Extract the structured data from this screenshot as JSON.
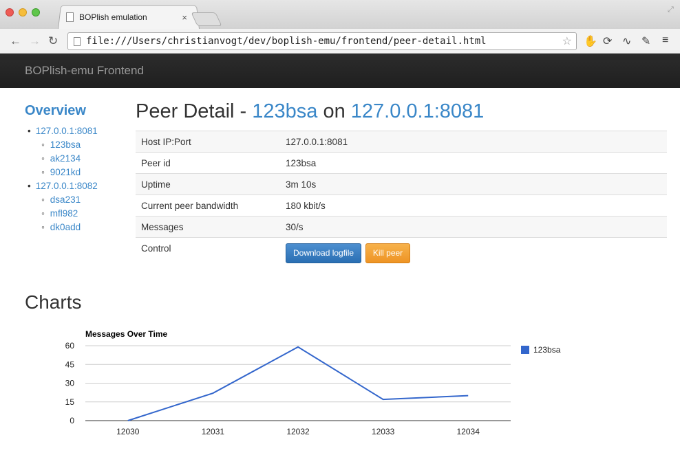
{
  "browser": {
    "tab_title": "BOPlish emulation",
    "tab_close": "×",
    "url": "file:///Users/christianvogt/dev/boplish-emu/frontend/peer-detail.html"
  },
  "navbar": {
    "brand": "BOPlish-emu Frontend"
  },
  "sidebar": {
    "heading": "Overview",
    "hosts": [
      {
        "label": "127.0.0.1:8081",
        "peers": [
          "123bsa",
          "ak2134",
          "9021kd"
        ]
      },
      {
        "label": "127.0.0.1:8082",
        "peers": [
          "dsa231",
          "mfl982",
          "dk0add"
        ]
      }
    ]
  },
  "page": {
    "title_prefix": "Peer Detail - ",
    "peer": "123bsa",
    "title_on": " on ",
    "host": "127.0.0.1:8081"
  },
  "details": [
    {
      "key": "Host IP:Port",
      "value": "127.0.0.1:8081"
    },
    {
      "key": "Peer id",
      "value": "123bsa"
    },
    {
      "key": "Uptime",
      "value": "3m 10s"
    },
    {
      "key": "Current peer bandwidth",
      "value": "180 kbit/s"
    },
    {
      "key": "Messages",
      "value": "30/s"
    }
  ],
  "control": {
    "label": "Control",
    "download_label": "Download logfile",
    "kill_label": "Kill peer"
  },
  "charts_heading": "Charts",
  "colors": {
    "accent": "#3a87c8",
    "series": "#3366cc",
    "warning": "#ee9425"
  },
  "chart_data": {
    "type": "line",
    "title": "Messages Over Time",
    "categories": [
      "12030",
      "12031",
      "12032",
      "12033",
      "12034"
    ],
    "series": [
      {
        "name": "123bsa",
        "values": [
          0,
          22,
          59,
          17,
          20
        ]
      }
    ],
    "yticks": [
      "0",
      "15",
      "30",
      "45",
      "60"
    ],
    "ylim": [
      0,
      60
    ],
    "grid": true,
    "legend": "right"
  }
}
